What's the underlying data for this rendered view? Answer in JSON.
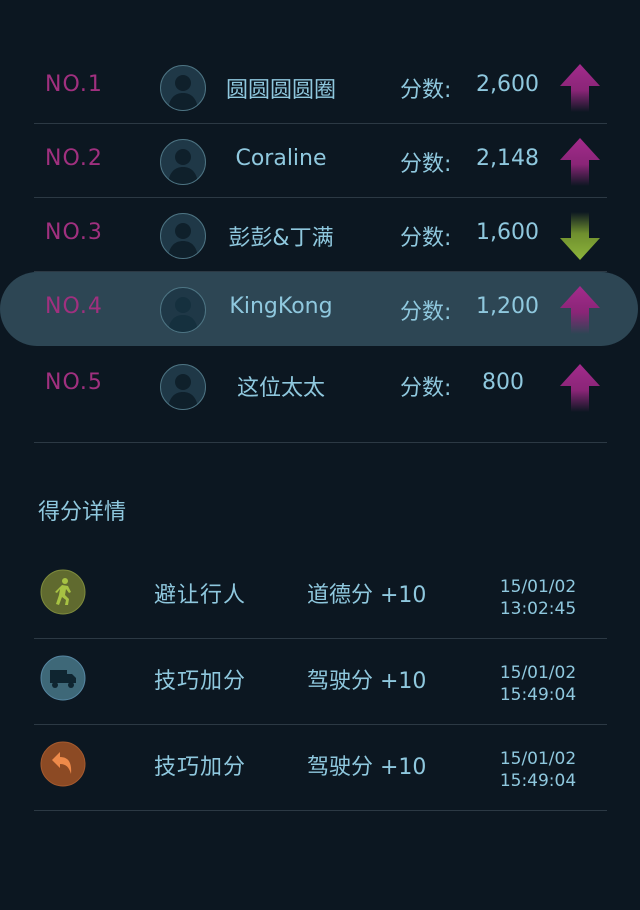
{
  "ranking": [
    {
      "no": "NO.1",
      "name": "圆圆圆圆圈",
      "score_label": "分数:",
      "score": "2,600",
      "trend": "up",
      "highlighted": false
    },
    {
      "no": "NO.2",
      "name": "Coraline",
      "score_label": "分数:",
      "score": "2,148",
      "trend": "up",
      "highlighted": false
    },
    {
      "no": "NO.3",
      "name": "彭彭&丁满",
      "score_label": "分数:",
      "score": "1,600",
      "trend": "down",
      "highlighted": false
    },
    {
      "no": "NO.4",
      "name": "KingKong",
      "score_label": "分数:",
      "score": "1,200",
      "trend": "up",
      "highlighted": true
    },
    {
      "no": "NO.5",
      "name": "这位太太",
      "score_label": "分数:",
      "score": "800",
      "trend": "up",
      "highlighted": false
    }
  ],
  "details": {
    "title": "得分详情",
    "items": [
      {
        "icon": "pedestrian-icon",
        "action": "避让行人",
        "points": "道德分 +10",
        "date": "15/01/02",
        "time": "13:02:45"
      },
      {
        "icon": "truck-icon",
        "action": "技巧加分",
        "points": "驾驶分 +10",
        "date": "15/01/02",
        "time": "15:49:04"
      },
      {
        "icon": "u-turn-icon",
        "action": "技巧加分",
        "points": "驾驶分 +10",
        "date": "15/01/02",
        "time": "15:49:04"
      }
    ]
  },
  "colors": {
    "background": "#0c1721",
    "rank_number": "#a0307f",
    "text": "#8fc8de",
    "highlight_row": "#2d4654",
    "arrow_up": "#a32b8c",
    "arrow_down": "#8db53b"
  }
}
